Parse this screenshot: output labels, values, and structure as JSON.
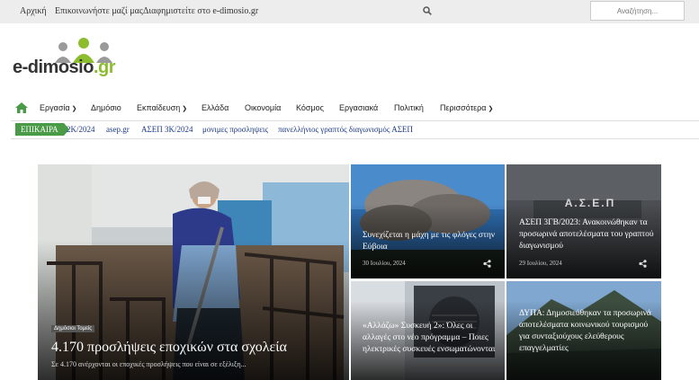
{
  "topbar": {
    "links": [
      "Αρχική",
      "Επικοινωνήστε μαζί μας",
      "Διαφημιστείτε στο e-dimosio.gr"
    ],
    "search_placeholder": "Αναζήτηση..."
  },
  "logo": {
    "text_main": "e-dimosio",
    "text_gr": ".gr"
  },
  "nav": {
    "items": [
      "Εργασία",
      "Δημόσιο",
      "Εκπαίδευση",
      "Ελλάδα",
      "Οικονομία",
      "Κόσμος",
      "Εργασιακά",
      "Πολιτική",
      "Περισσότερα"
    ]
  },
  "tags": {
    "label": "ΕΠΙΚΑΙΡΑ",
    "items": [
      "2Κ/2024",
      "asep.gr",
      "ΑΣΕΠ 3Κ/2024",
      "μονιμες προσληψεις",
      "πανελλήνιος γραπτός διαγωνισμός ΑΣΕΠ"
    ]
  },
  "articles": {
    "main": {
      "category": "Δημόσιοι Τομείς",
      "title": "4.170 προσλήψεις εποχικών στα σχολεία",
      "excerpt": "Σε 4.170 ανέρχονται οι εποχικές προσλήψεις που είναι σε εξέλιξη..."
    },
    "a1": {
      "title": "Συνεχίζεται η μάχη με τις φλόγες στην Εύβοια",
      "date": "30 Ιουλίου, 2024"
    },
    "a2": {
      "title": "ΑΣΕΠ 3ΓΒ/2023: Ανακοινώθηκαν τα προσωρινά αποτελέσματα του γραπτού διαγωνισμού",
      "date": "29 Ιουλίου, 2024"
    },
    "a3": {
      "title": "«Αλλάζω» Συσκευή 2»: Όλες οι αλλαγές στο νέο πρόγραμμα – Ποιες ηλεκτρικές συσκευές ενσωματώνονται"
    },
    "a4": {
      "title": "ΔΥΠΑ: Δημοσιεύθηκαν τα προσωρινά αποτελέσματα κοινωνικού τουρισμού για συνταξιούχους ελεύθερους επαγγελματίες"
    }
  },
  "colors": {
    "accent_green": "#4a9b47",
    "link_blue": "#1a3a8a",
    "topbar_bg": "#ededed"
  }
}
